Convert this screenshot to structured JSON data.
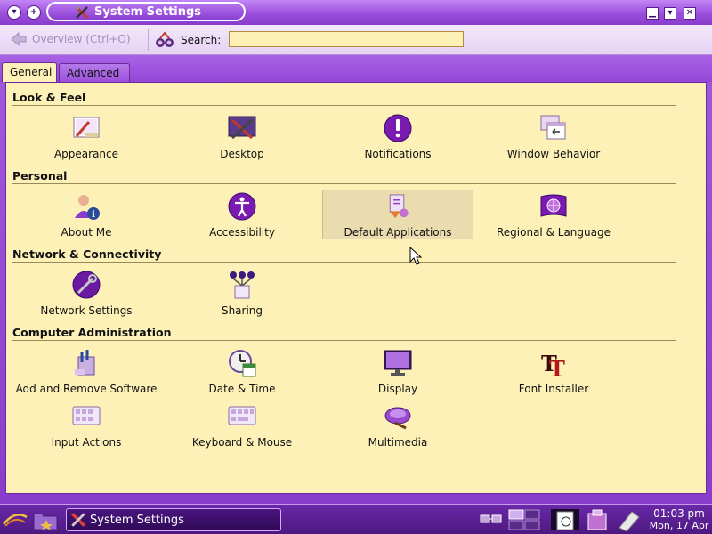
{
  "window": {
    "title": "System Settings"
  },
  "toolbar": {
    "overview_label": "Overview (Ctrl+O)",
    "search_label": "Search:",
    "search_value": ""
  },
  "tabs": [
    {
      "label": "General",
      "active": true
    },
    {
      "label": "Advanced",
      "active": false
    }
  ],
  "sections": [
    {
      "title": "Look & Feel",
      "items": [
        {
          "label": "Appearance",
          "icon": "appearance-icon"
        },
        {
          "label": "Desktop",
          "icon": "desktop-icon"
        },
        {
          "label": "Notifications",
          "icon": "notifications-icon"
        },
        {
          "label": "Window Behavior",
          "icon": "window-behavior-icon"
        }
      ]
    },
    {
      "title": "Personal",
      "items": [
        {
          "label": "About Me",
          "icon": "about-me-icon"
        },
        {
          "label": "Accessibility",
          "icon": "accessibility-icon"
        },
        {
          "label": "Default Applications",
          "icon": "default-applications-icon",
          "hovered": true
        },
        {
          "label": "Regional & Language",
          "icon": "regional-language-icon"
        }
      ]
    },
    {
      "title": "Network & Connectivity",
      "items": [
        {
          "label": "Network Settings",
          "icon": "network-settings-icon"
        },
        {
          "label": "Sharing",
          "icon": "sharing-icon"
        }
      ]
    },
    {
      "title": "Computer Administration",
      "items": [
        {
          "label": "Add and Remove Software",
          "icon": "add-remove-software-icon"
        },
        {
          "label": "Date & Time",
          "icon": "date-time-icon"
        },
        {
          "label": "Display",
          "icon": "display-icon"
        },
        {
          "label": "Font Installer",
          "icon": "font-installer-icon"
        },
        {
          "label": "Input Actions",
          "icon": "input-actions-icon"
        },
        {
          "label": "Keyboard & Mouse",
          "icon": "keyboard-mouse-icon"
        },
        {
          "label": "Multimedia",
          "icon": "multimedia-icon"
        }
      ]
    }
  ],
  "taskbar": {
    "task_label": "System Settings",
    "time": "01:03 pm",
    "date": "Mon, 17 Apr"
  },
  "colors": {
    "window_purple": "#8a3ccc",
    "content_bg": "#fdf1b8",
    "search_bg": "#fdf1b8"
  }
}
